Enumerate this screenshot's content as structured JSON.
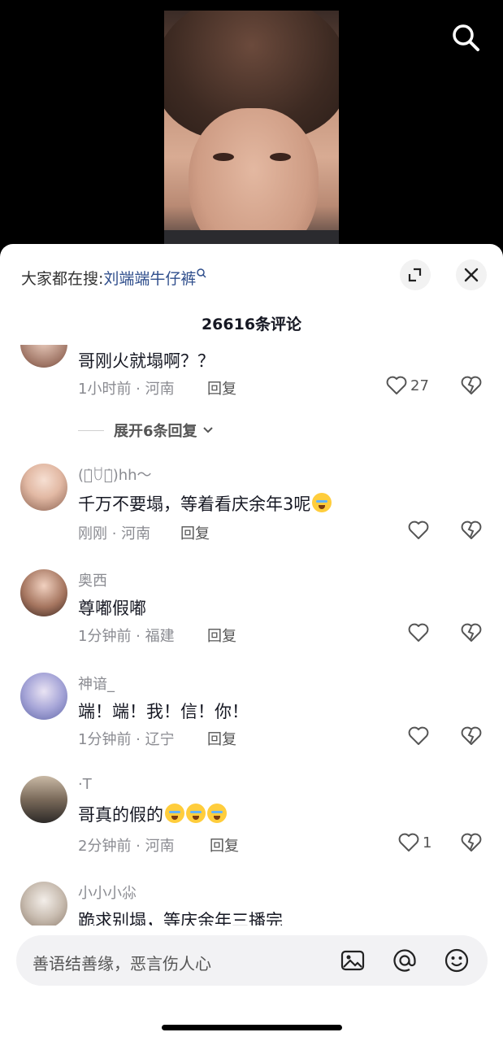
{
  "hot_search": {
    "prefix": "大家都在搜:",
    "term": "刘端端牛仔裤",
    "icon": "search-small-icon"
  },
  "comment_count_title": "26616条评论",
  "comments": [
    {
      "user": "",
      "text": "哥刚火就塌啊？？",
      "meta": "1小时前 · 河南",
      "reply_label": "回复",
      "likes": "27"
    },
    {
      "user": "(꒪̇ꇴ꒪̇)hh～",
      "text": "千万不要塌，等着看庆余年3呢",
      "meta": "刚刚 · 河南",
      "reply_label": "回复",
      "likes": ""
    },
    {
      "user": "奥西",
      "text": "尊嘟假嘟",
      "meta": "1分钟前 · 福建",
      "reply_label": "回复",
      "likes": ""
    },
    {
      "user": "神谙_",
      "text": "端！端！我！信！你！",
      "meta": "1分钟前 · 辽宁",
      "reply_label": "回复",
      "likes": ""
    },
    {
      "user": "·T",
      "text": "哥真的假的",
      "meta": "2分钟前 · 河南",
      "reply_label": "回复",
      "likes": "1"
    },
    {
      "user": "小小小尛",
      "text": "跪求别塌，等庆余年三播完",
      "meta": "",
      "reply_label": "",
      "likes": ""
    }
  ],
  "expand_replies": "展开6条回复",
  "input": {
    "placeholder": "善语结善缘，恶言伤人心"
  },
  "colors": {
    "link": "#2f4e8c",
    "text": "#161823",
    "meta": "#8a8b91",
    "sheet_bg": "#ffffff"
  }
}
